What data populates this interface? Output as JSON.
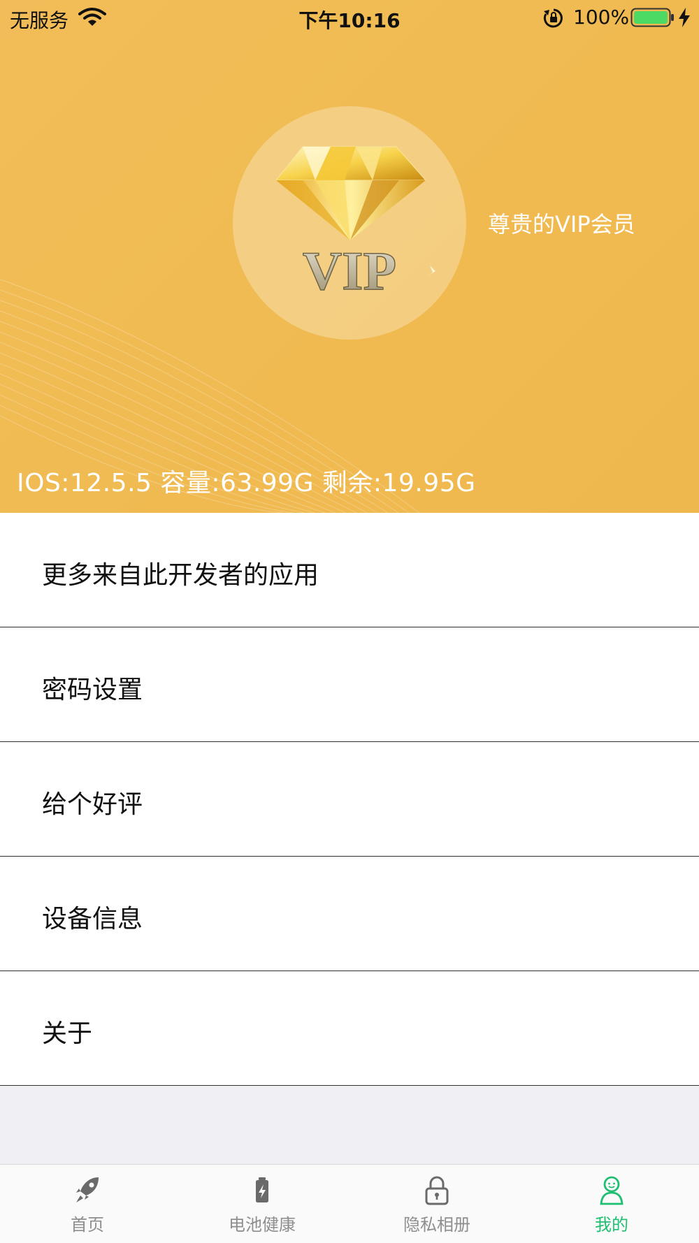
{
  "status_bar": {
    "carrier": "无服务",
    "time": "下午10:16",
    "battery_percent": "100%"
  },
  "header": {
    "vip_logo_text": "VIP",
    "vip_title": "尊贵的VIP会员",
    "device_info": "IOS:12.5.5 容量:63.99G 剩余:19.95G"
  },
  "menu": {
    "items": [
      {
        "label": "更多来自此开发者的应用"
      },
      {
        "label": "密码设置"
      },
      {
        "label": "给个好评"
      },
      {
        "label": "设备信息"
      },
      {
        "label": "关于"
      }
    ]
  },
  "tabbar": {
    "active_color": "#1fbf72",
    "tabs": [
      {
        "label": "首页",
        "icon": "rocket-icon"
      },
      {
        "label": "电池健康",
        "icon": "battery-icon"
      },
      {
        "label": "隐私相册",
        "icon": "lock-icon"
      },
      {
        "label": "我的",
        "icon": "person-icon"
      }
    ]
  },
  "colors": {
    "header_bg": "#f0bb52",
    "battery_fill": "#4cd964"
  }
}
